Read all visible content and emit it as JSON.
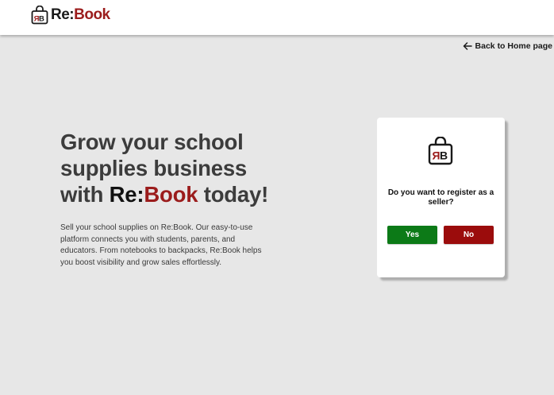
{
  "header": {
    "logo_re": "Re:",
    "logo_book": "Book",
    "logo_icon": "rebook-bag-icon"
  },
  "nav": {
    "back_label": "Back to Home page",
    "back_icon": "arrow-left-icon"
  },
  "hero": {
    "headline_line1": "Grow your school",
    "headline_line2": "supplies business",
    "headline_with": "with ",
    "headline_re": "Re:",
    "headline_book": "Book",
    "headline_today": " today!",
    "description": "Sell your school supplies on Re:Book. Our easy-to-use platform connects you with students, parents, and educators. From notebooks to backpacks, Re:Book helps you boost visibility and grow sales effortlessly."
  },
  "dialog": {
    "icon": "rebook-bag-icon",
    "question": "Do you want to register as a seller?",
    "yes_label": "Yes",
    "no_label": "No"
  },
  "colors": {
    "brand_red": "#9b1c1c",
    "yes_green": "#0c7a17",
    "no_red": "#9b0c0c",
    "background": "#e7e7e7"
  }
}
